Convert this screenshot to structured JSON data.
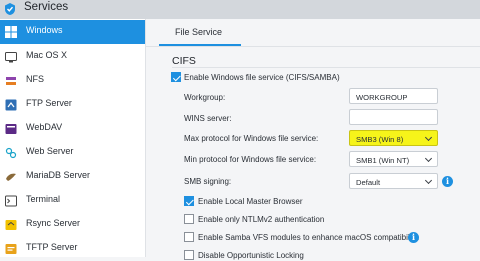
{
  "window": {
    "title": "Services"
  },
  "colors": {
    "accent": "#1e90e0",
    "highlight": "#f6f41a"
  },
  "sidebar": {
    "items": [
      {
        "label": "Windows",
        "icon": "windows-icon",
        "active": true
      },
      {
        "label": "Mac OS X",
        "icon": "apple-icon",
        "active": false
      },
      {
        "label": "NFS",
        "icon": "nfs-icon",
        "active": false
      },
      {
        "label": "FTP Server",
        "icon": "ftp-icon",
        "active": false
      },
      {
        "label": "WebDAV",
        "icon": "webdav-icon",
        "active": false
      },
      {
        "label": "Web Server",
        "icon": "web-server-icon",
        "active": false
      },
      {
        "label": "MariaDB Server",
        "icon": "database-icon",
        "active": false
      },
      {
        "label": "Terminal",
        "icon": "terminal-icon",
        "active": false
      },
      {
        "label": "Rsync Server",
        "icon": "rsync-icon",
        "active": false
      },
      {
        "label": "TFTP Server",
        "icon": "tftp-icon",
        "active": false
      }
    ]
  },
  "main": {
    "tab": "File Service",
    "section": "CIFS",
    "enable_label": "Enable Windows file service (CIFS/SAMBA)",
    "enable_checked": true,
    "workgroup": {
      "label": "Workgroup:",
      "value": "WORKGROUP"
    },
    "wins": {
      "label": "WINS server:",
      "value": ""
    },
    "max_protocol": {
      "label": "Max protocol for Windows file service:",
      "value": "SMB3 (Win 8)"
    },
    "min_protocol": {
      "label": "Min protocol for Windows file service:",
      "value": "SMB1 (Win NT)"
    },
    "signing": {
      "label": "SMB signing:",
      "value": "Default"
    },
    "options": [
      {
        "label": "Enable Local Master Browser",
        "checked": true
      },
      {
        "label": "Enable only NTLMv2 authentication",
        "checked": false
      },
      {
        "label": "Enable Samba VFS modules to enhance macOS compatibility.",
        "checked": false
      },
      {
        "label": "Disable Opportunistic Locking",
        "checked": false
      }
    ]
  }
}
